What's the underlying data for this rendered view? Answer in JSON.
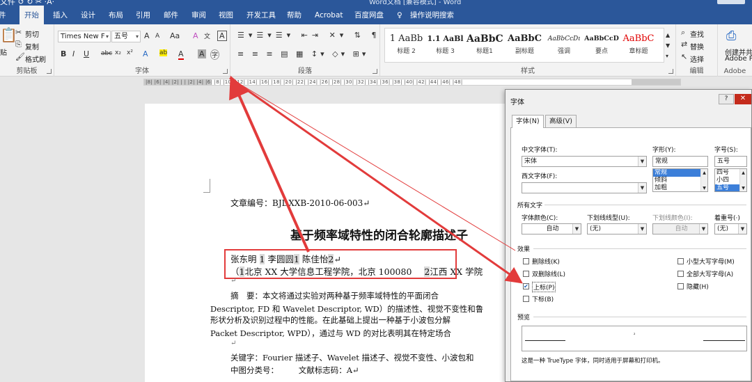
{
  "titlebar": {
    "quick_access": "文件 ↺ ↻ ✂ ·A·",
    "doc_title": "Word文档 [兼容模式] - Word",
    "window_color": "#2b579a"
  },
  "tabs": [
    "件",
    "开始",
    "插入",
    "设计",
    "布局",
    "引用",
    "邮件",
    "审阅",
    "视图",
    "开发工具",
    "帮助",
    "Acrobat",
    "百度网盘",
    "操作说明搜索"
  ],
  "ribbon": {
    "clipboard": {
      "paste": "贴",
      "cut": "剪切",
      "copy": "复制",
      "format_painter": "格式刷",
      "label": "剪贴板"
    },
    "font": {
      "font_name": "Times New F",
      "font_size": "五号",
      "grow": "A",
      "shrink": "A",
      "case": "Aa",
      "clear": "A",
      "phonetic": "文",
      "border_char": "A",
      "bold": "B",
      "italic": "I",
      "underline": "U",
      "strike": "abc",
      "subscript": "x₂",
      "superscript": "x²",
      "effects": "A",
      "highlight": "ab",
      "color": "A",
      "shading": "A",
      "circle": "字",
      "label": "字体"
    },
    "paragraph": {
      "label": "段落"
    },
    "styles": {
      "items": [
        {
          "sample": "1 AaBb",
          "name": "标题 2"
        },
        {
          "sample": "1.1 AaBl",
          "name": "标题 3"
        },
        {
          "sample": "AaBbC",
          "name": "标题1"
        },
        {
          "sample": "AaBbC",
          "name": "副标题"
        },
        {
          "sample": "AaBbCcDı",
          "name": "强调"
        },
        {
          "sample": "AaBbCcD",
          "name": "要点"
        },
        {
          "sample": "AaBbC",
          "name": "章标题"
        }
      ],
      "label": "样式"
    },
    "editing": {
      "find": "查找",
      "replace": "替换",
      "select": "选择",
      "label": "编辑"
    },
    "adobe": {
      "line1": "创建并共",
      "line2": "Adobe P",
      "label": "Adobe"
    }
  },
  "ruler": {
    "marks": "|8| |6| |4| |2| | | |2| |4| |6| |8| |10| |12| |14| |16| |18| |20| |22| |24| |26| |28| |30| |32| |34| |36| |38| |40| |42| |44| |46| |48|"
  },
  "document": {
    "article_no": "文章编号：BJDXXB-2010-06-003↵",
    "title": "基于频率域特性的闭合轮廓描述子",
    "authors": {
      "a1": "张东明",
      "s1": "1",
      "a2": "李圆圆",
      "s2": "1",
      "a3": "陈佳怡",
      "s3": "2",
      "end": "↵"
    },
    "affiliation": {
      "open": "（",
      "s1": "1",
      "text1": "北京 XX 大学信息工程学院，北京 100080",
      "s2": "2",
      "text2": "江西 XX 学院"
    },
    "mark1": "↵",
    "abstract_1": "摘　要：本文将通过实验对两种基于频率域特性的平面闭合",
    "abstract_2": "Descriptor, FD 和 Wavelet Descriptor, WD）的描述性、视觉不变性和鲁",
    "abstract_3": "形状分析及识别过程中的性能。在此基础上提出一种基于小波包分解",
    "abstract_4": "Packet Descriptor, WPD），通过与 WD 的对比表明其在特定场合",
    "mark2": "↵",
    "keywords": "关键字：Fourier 描述子、Wavelet 描述子、视觉不变性、小波包和",
    "classification": "中图分类号：　　　文献标志码：A↵"
  },
  "dialog": {
    "title": "字体",
    "help": "?",
    "close": "✕",
    "tabs": [
      "字体(N)",
      "高级(V)"
    ],
    "cn_font_label": "中文字体(T):",
    "cn_font_value": "宋体",
    "west_font_label": "西文字体(F):",
    "west_font_value": "",
    "style_label": "字形(Y):",
    "style_value": "常规",
    "style_options": [
      "常规",
      "倾斜",
      "加粗"
    ],
    "size_label": "字号(S):",
    "size_value": "五号",
    "size_options": [
      "四号",
      "小四",
      "五号"
    ],
    "all_text": "所有文字",
    "color_label": "字体颜色(C):",
    "color_value": "自动",
    "underline_label": "下划线线型(U):",
    "underline_value": "(无)",
    "ul_color_label": "下划线颜色(I):",
    "ul_color_value": "自动",
    "emphasis_label": "着重号(·)",
    "emphasis_value": "(无)",
    "effects": "效果",
    "cb_strike": "删除线(K)",
    "cb_double": "双删除线(L)",
    "cb_super": "上标(P)",
    "cb_sub": "下标(B)",
    "cb_smallcaps": "小型大写字母(M)",
    "cb_allcaps": "全部大写字母(A)",
    "cb_hidden": "隐藏(H)",
    "super_checked": true,
    "preview": "预览",
    "preview_char": "²",
    "note": "这是一种 TrueType 字体，同时适用于屏幕和打印机。"
  },
  "annotation_color": "#e23b3b"
}
